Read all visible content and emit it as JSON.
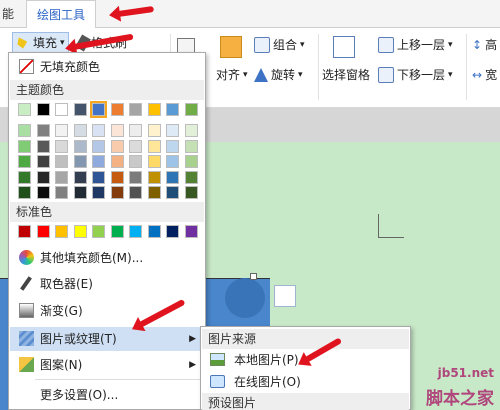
{
  "tabs": [
    {
      "label": "能"
    },
    {
      "label": "绘图工具"
    }
  ],
  "ribbon": {
    "fill_label": "填充",
    "format_brush_label": "格式刷",
    "align_label": "对齐",
    "rotate_label": "旋转",
    "group_label": "组合",
    "selection_pane_label": "选择窗格",
    "bring_forward_label": "上移一层",
    "send_backward_label": "下移一层",
    "height_label": "高",
    "width_label": "宽"
  },
  "fill_menu": {
    "no_fill_label": "无填充颜色",
    "theme_colors_header": "主题颜色",
    "theme_colors_top": [
      "#c9eec4",
      "#000000",
      "#ffffff",
      "#44546a",
      "#4472c4",
      "#ed7d31",
      "#a5a5a5",
      "#ffc000",
      "#5b9bd5",
      "#70ad47"
    ],
    "theme_colors_shades": [
      [
        "#a9dfa3",
        "#808080",
        "#f2f2f2",
        "#d5dce4",
        "#d9e2f3",
        "#fbe5d6",
        "#ededed",
        "#fff2cc",
        "#deebf7",
        "#e2f0d9"
      ],
      [
        "#7fcc75",
        "#595959",
        "#d9d9d9",
        "#acb9ca",
        "#b4c7e7",
        "#f8cbad",
        "#dbdbdb",
        "#ffe699",
        "#bdd7ee",
        "#c5e0b4"
      ],
      [
        "#4ea943",
        "#404040",
        "#bfbfbf",
        "#8497b0",
        "#8faadc",
        "#f4b183",
        "#c9c9c9",
        "#ffd966",
        "#9dc3e6",
        "#a9d18e"
      ],
      [
        "#327a2a",
        "#262626",
        "#a6a6a6",
        "#333f50",
        "#2f5597",
        "#c55a11",
        "#7b7b7b",
        "#bf9000",
        "#2e75b6",
        "#548235"
      ],
      [
        "#1f4f1a",
        "#0d0d0d",
        "#808080",
        "#222a35",
        "#1f3864",
        "#843c0c",
        "#525252",
        "#7f6000",
        "#1f4e79",
        "#385723"
      ]
    ],
    "standard_colors_header": "标准色",
    "standard_colors": [
      "#c00000",
      "#ff0000",
      "#ffc000",
      "#ffff00",
      "#92d050",
      "#00b050",
      "#00b0f0",
      "#0070c0",
      "#002060",
      "#7030a0"
    ],
    "more_colors_label": "其他填充颜色(M)...",
    "eyedropper_label": "取色器(E)",
    "gradient_label": "渐变(G)",
    "picture_texture_label": "图片或纹理(T)",
    "pattern_label": "图案(N)",
    "more_settings_label": "更多设置(O)..."
  },
  "submenu": {
    "picture_source_header": "图片来源",
    "local_picture_label": "本地图片(P)...",
    "online_picture_label": "在线图片(O)",
    "preset_picture_header": "预设图片"
  },
  "watermark": {
    "url": "jb51.net",
    "text": "脚本之家"
  },
  "colors": {
    "accent": "#2b63c6",
    "annotation_arrow": "#e0141e",
    "slide_background": "#c8e9c8",
    "menu_highlight": "#cfe0f5"
  }
}
